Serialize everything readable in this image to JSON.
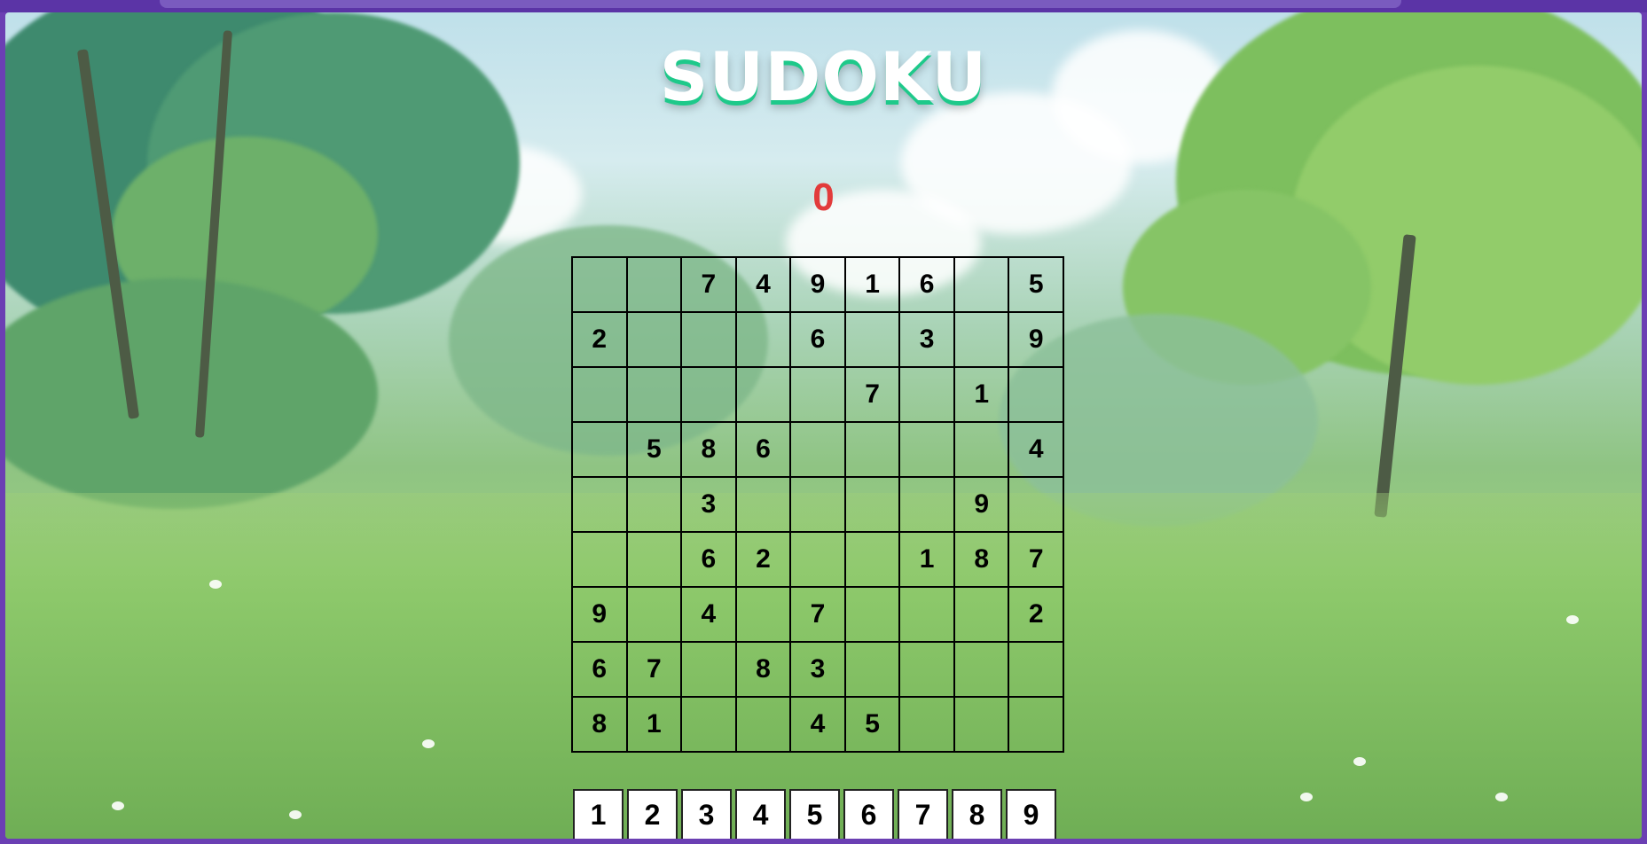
{
  "game": {
    "title": "SUDOKU",
    "score": "0",
    "colors": {
      "title": "#ffffff",
      "title_shadow": "#1ec98a",
      "score": "#e23b3b"
    },
    "background": "illustrated-meadow-with-trees"
  },
  "board": {
    "rows": [
      [
        "",
        "",
        "7",
        "4",
        "9",
        "1",
        "6",
        "",
        "5"
      ],
      [
        "2",
        "",
        "",
        "",
        "6",
        "",
        "3",
        "",
        "9"
      ],
      [
        "",
        "",
        "",
        "",
        "",
        "7",
        "",
        "1",
        ""
      ],
      [
        "",
        "5",
        "8",
        "6",
        "",
        "",
        "",
        "",
        "4"
      ],
      [
        "",
        "",
        "3",
        "",
        "",
        "",
        "",
        "9",
        ""
      ],
      [
        "",
        "",
        "6",
        "2",
        "",
        "",
        "1",
        "8",
        "7"
      ],
      [
        "9",
        "",
        "4",
        "",
        "7",
        "",
        "",
        "",
        "2"
      ],
      [
        "6",
        "7",
        "",
        "8",
        "3",
        "",
        "",
        "",
        ""
      ],
      [
        "8",
        "1",
        "",
        "",
        "4",
        "5",
        "",
        "",
        ""
      ]
    ]
  },
  "numpad": {
    "buttons": [
      "1",
      "2",
      "3",
      "4",
      "5",
      "6",
      "7",
      "8",
      "9"
    ]
  }
}
